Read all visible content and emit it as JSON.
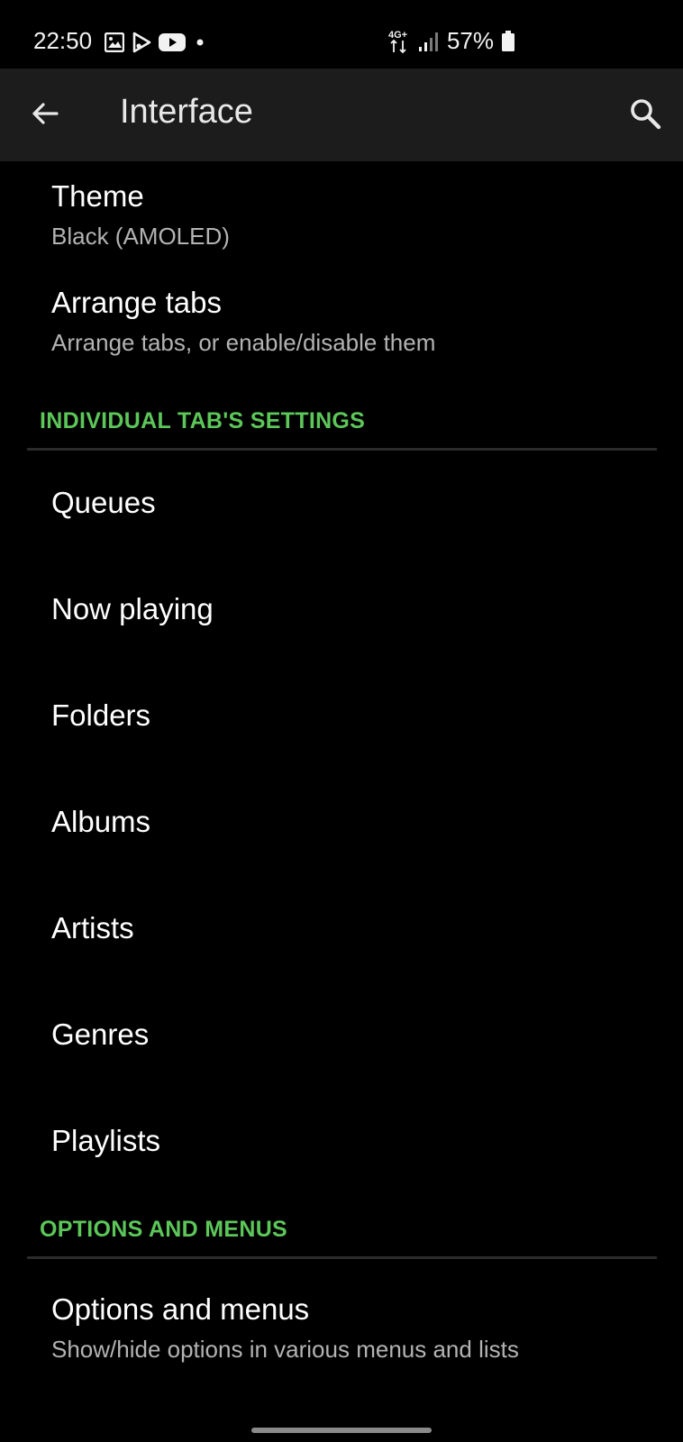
{
  "status_bar": {
    "time": "22:50",
    "network": "4G+",
    "battery": "57%",
    "left_icons": [
      "gallery-icon",
      "play-store-icon",
      "youtube-icon",
      "notification-dot-icon"
    ],
    "right_icons": [
      "data-arrows-icon",
      "signal-icon",
      "battery-icon"
    ]
  },
  "app_bar": {
    "title": "Interface",
    "back_icon": "arrow-back-icon",
    "search_icon": "search-icon"
  },
  "top_items": [
    {
      "title": "Theme",
      "summary": "Black (AMOLED)"
    },
    {
      "title": "Arrange tabs",
      "summary": "Arrange tabs, or enable/disable them"
    }
  ],
  "tab_settings": {
    "header": "INDIVIDUAL TAB'S SETTINGS",
    "items": [
      "Queues",
      "Now playing",
      "Folders",
      "Albums",
      "Artists",
      "Genres",
      "Playlists"
    ]
  },
  "options_section": {
    "header": "OPTIONS AND MENUS",
    "item": {
      "title": "Options and menus",
      "summary": "Show/hide options in various menus and lists"
    }
  },
  "colors": {
    "accent": "#5cc659",
    "background": "#000000",
    "app_bar": "#1c1c1c",
    "text_primary": "#ffffff",
    "text_secondary": "#b3b3b3"
  }
}
